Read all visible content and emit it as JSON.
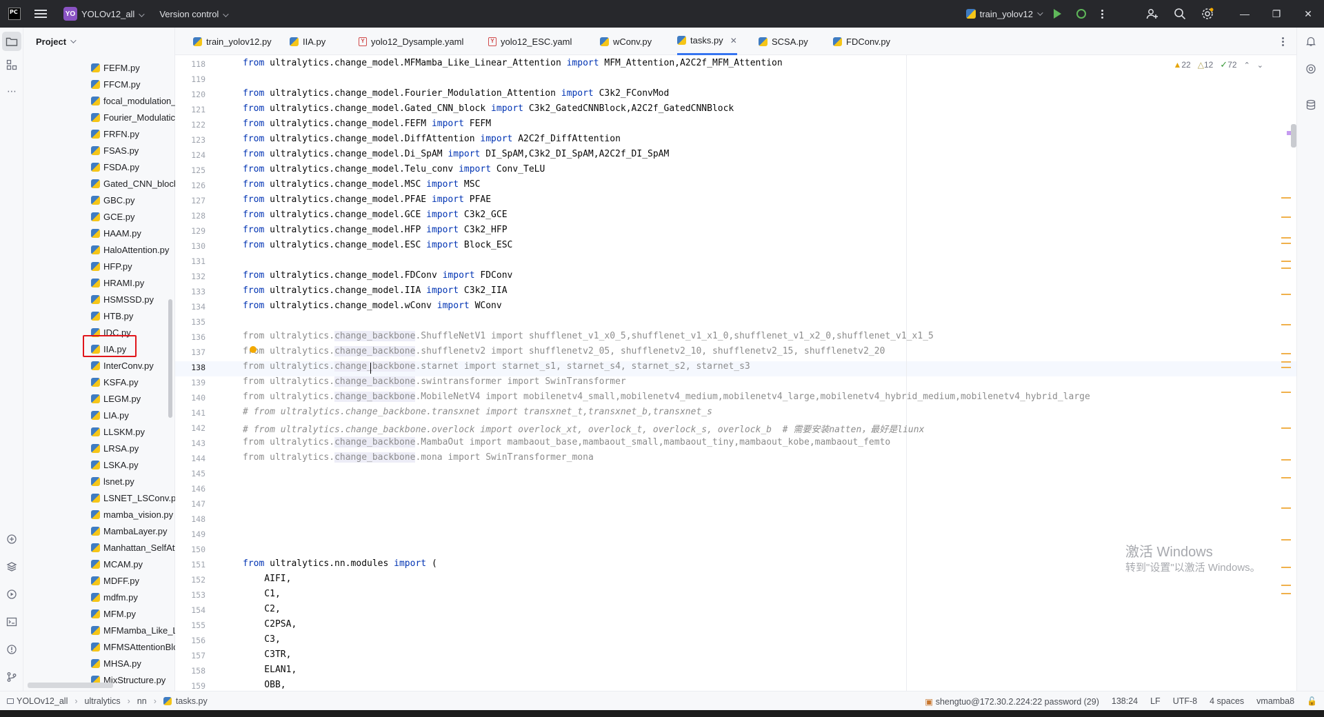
{
  "titlebar": {
    "app_logo": "PC",
    "project_badge": "YO",
    "project_name": "YOLOv12_all",
    "vcs_label": "Version control",
    "run_config": "train_yolov12"
  },
  "project_panel": {
    "title": "Project",
    "files": [
      "FEFM.py",
      "FFCM.py",
      "focal_modulation_",
      "Fourier_Modulatic",
      "FRFN.py",
      "FSAS.py",
      "FSDA.py",
      "Gated_CNN_block",
      "GBC.py",
      "GCE.py",
      "HAAM.py",
      "HaloAttention.py",
      "HFP.py",
      "HRAMI.py",
      "HSMSSD.py",
      "HTB.py",
      "IDC.py",
      "IIA.py",
      "InterConv.py",
      "KSFA.py",
      "LEGM.py",
      "LIA.py",
      "LLSKM.py",
      "LRSA.py",
      "LSKA.py",
      "lsnet.py",
      "LSNET_LSConv.py",
      "mamba_vision.py",
      "MambaLayer.py",
      "Manhattan_SelfAtt",
      "MCAM.py",
      "MDFF.py",
      "mdfm.py",
      "MFM.py",
      "MFMamba_Like_L",
      "MFMSAttentionBlc",
      "MHSA.py",
      "MixStructure.py"
    ]
  },
  "tabs": [
    {
      "label": "train_yolov12.py",
      "icon": "python-icon"
    },
    {
      "label": "IIA.py",
      "icon": "python-icon"
    },
    {
      "label": "yolo12_Dysample.yaml",
      "icon": "yaml-icon"
    },
    {
      "label": "yolo12_ESC.yaml",
      "icon": "yaml-icon"
    },
    {
      "label": "wConv.py",
      "icon": "python-icon"
    },
    {
      "label": "tasks.py",
      "icon": "python-icon",
      "active": true
    },
    {
      "label": "SCSA.py",
      "icon": "python-icon"
    },
    {
      "label": "FDConv.py",
      "icon": "python-icon"
    }
  ],
  "editor": {
    "inspections": {
      "warnings": "22",
      "weak_warnings": "12",
      "ok": "72"
    },
    "lines": [
      {
        "n": "118",
        "kind": "import",
        "from": "ultralytics.change_model.MFMamba_Like_Linear_Attention",
        "names": "MFM_Attention,A2C2f_MFM_Attention"
      },
      {
        "n": "119",
        "kind": "blank"
      },
      {
        "n": "120",
        "kind": "import",
        "from": "ultralytics.change_model.Fourier_Modulation_Attention",
        "names": "C3k2_FConvMod"
      },
      {
        "n": "121",
        "kind": "import",
        "from": "ultralytics.change_model.Gated_CNN_block",
        "names": "C3k2_GatedCNNBlock,A2C2f_GatedCNNBlock"
      },
      {
        "n": "122",
        "kind": "import",
        "from": "ultralytics.change_model.FEFM",
        "names": "FEFM"
      },
      {
        "n": "123",
        "kind": "import",
        "from": "ultralytics.change_model.DiffAttention",
        "names": "A2C2f_DiffAttention"
      },
      {
        "n": "124",
        "kind": "import",
        "from": "ultralytics.change_model.Di_SpAM",
        "names": "DI_SpAM,C3k2_DI_SpAM,A2C2f_DI_SpAM"
      },
      {
        "n": "125",
        "kind": "import",
        "from": "ultralytics.change_model.Telu_conv",
        "names": "Conv_TeLU"
      },
      {
        "n": "126",
        "kind": "import",
        "from": "ultralytics.change_model.MSC",
        "names": "MSC"
      },
      {
        "n": "127",
        "kind": "import",
        "from": "ultralytics.change_model.PFAE",
        "names": "PFAE"
      },
      {
        "n": "128",
        "kind": "import",
        "from": "ultralytics.change_model.GCE",
        "names": "C3k2_GCE"
      },
      {
        "n": "129",
        "kind": "import",
        "from": "ultralytics.change_model.HFP",
        "names": "C3k2_HFP"
      },
      {
        "n": "130",
        "kind": "import",
        "from": "ultralytics.change_model.ESC",
        "names": "Block_ESC"
      },
      {
        "n": "131",
        "kind": "blank"
      },
      {
        "n": "132",
        "kind": "import",
        "from": "ultralytics.change_model.FDConv",
        "names": "FDConv"
      },
      {
        "n": "133",
        "kind": "import",
        "from": "ultralytics.change_model.IIA",
        "names": "C3k2_IIA"
      },
      {
        "n": "134",
        "kind": "import",
        "from": "ultralytics.change_model.wConv",
        "names": "WConv"
      },
      {
        "n": "135",
        "kind": "blank"
      },
      {
        "n": "136",
        "kind": "dim",
        "module": "ShuffleNetV1",
        "names": "shufflenet_v1_x0_5,shufflenet_v1_x1_0,shufflenet_v1_x2_0,shufflenet_v1_x1_5"
      },
      {
        "n": "137",
        "kind": "dim",
        "module": "shufflenetv2",
        "names": "shufflenetv2_05, shufflenetv2_10, shufflenetv2_15, shufflenetv2_20"
      },
      {
        "n": "138",
        "kind": "dim",
        "module": "starnet",
        "names": "starnet_s1, starnet_s4, starnet_s2, starnet_s3"
      },
      {
        "n": "139",
        "kind": "dim",
        "module": "swintransformer",
        "names": "SwinTransformer"
      },
      {
        "n": "140",
        "kind": "dim",
        "module": "MobileNetV4",
        "names": "mobilenetv4_small,mobilenetv4_medium,mobilenetv4_large,mobilenetv4_hybrid_medium,mobilenetv4_hybrid_large"
      },
      {
        "n": "141",
        "kind": "comment",
        "text": "# from ultralytics.change_backbone.transxnet import transxnet_t,transxnet_b,transxnet_s"
      },
      {
        "n": "142",
        "kind": "comment",
        "text": "# from ultralytics.change_backbone.overlock import overlock_xt, overlock_t, overlock_s, overlock_b  # 需要安装natten，最好是liunx"
      },
      {
        "n": "143",
        "kind": "dim",
        "module": "MambaOut",
        "names": "mambaout_base,mambaout_small,mambaout_tiny,mambaout_kobe,mambaout_femto"
      },
      {
        "n": "144",
        "kind": "dim",
        "module": "mona",
        "names": "SwinTransformer_mona"
      },
      {
        "n": "145",
        "kind": "blank"
      },
      {
        "n": "146",
        "kind": "blank"
      },
      {
        "n": "147",
        "kind": "blank"
      },
      {
        "n": "148",
        "kind": "blank"
      },
      {
        "n": "149",
        "kind": "blank"
      },
      {
        "n": "150",
        "kind": "blank"
      },
      {
        "n": "151",
        "kind": "open",
        "from": "ultralytics.nn.modules",
        "names": "("
      },
      {
        "n": "152",
        "kind": "item",
        "text": "    AIFI,"
      },
      {
        "n": "153",
        "kind": "item",
        "text": "    C1,"
      },
      {
        "n": "154",
        "kind": "item",
        "text": "    C2,"
      },
      {
        "n": "155",
        "kind": "item",
        "text": "    C2PSA,"
      },
      {
        "n": "156",
        "kind": "item",
        "text": "    C3,"
      },
      {
        "n": "157",
        "kind": "item",
        "text": "    C3TR,"
      },
      {
        "n": "158",
        "kind": "item",
        "text": "    ELAN1,"
      },
      {
        "n": "159",
        "kind": "item",
        "text": "    OBB,"
      }
    ],
    "watermark": {
      "line1": "激活 Windows",
      "line2": "转到\"设置\"以激活 Windows。"
    }
  },
  "statusbar": {
    "breadcrumbs": [
      "YOLOv12_all",
      "ultralytics",
      "nn",
      "tasks.py"
    ],
    "interpreter_host": "shengtuo@172.30.2.224:22 password (29)",
    "caret_position": "138:24",
    "line_separator": "LF",
    "encoding": "UTF-8",
    "indent": "4 spaces",
    "env": "vmamba8"
  }
}
